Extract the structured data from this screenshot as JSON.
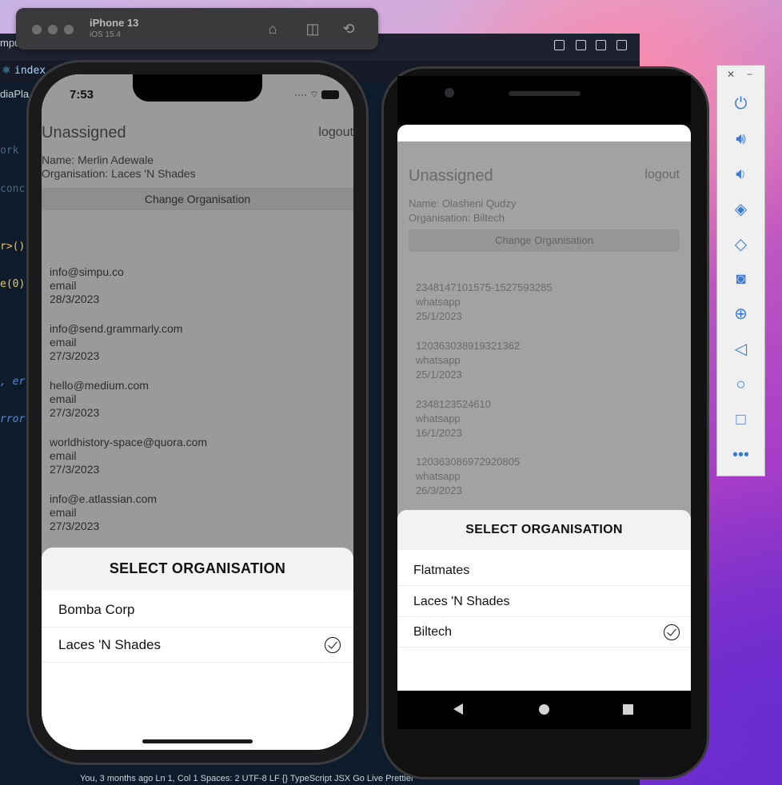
{
  "simulator": {
    "device_name": "iPhone 13",
    "os_version": "iOS 15.4"
  },
  "editor": {
    "tab_label": "index",
    "sidebar_fragment": "diaPla",
    "top_fragment": "mpu",
    "status_bar": "You, 3 months ago    Ln 1, Col 1    Spaces: 2    UTF-8    LF    {} TypeScript JSX    Go Live    Prettier",
    "code_fragments": [
      "ork",
      "conc",
      "r>()",
      "e(0)",
      ", er",
      "rror"
    ]
  },
  "ios": {
    "time": "7:53",
    "title": "Unassigned",
    "logout": "logout",
    "name_line": "Name: Merlin Adewale",
    "org_line": "Organisation: Laces 'N Shades",
    "change_button": "Change Organisation",
    "items": [
      {
        "contact": "info@simpu.co",
        "channel": "email",
        "date": "28/3/2023"
      },
      {
        "contact": "info@send.grammarly.com",
        "channel": "email",
        "date": "27/3/2023"
      },
      {
        "contact": "hello@medium.com",
        "channel": "email",
        "date": "27/3/2023"
      },
      {
        "contact": "worldhistory-space@quora.com",
        "channel": "email",
        "date": "27/3/2023"
      },
      {
        "contact": "info@e.atlassian.com",
        "channel": "email",
        "date": "27/3/2023"
      }
    ],
    "sheet_title": "SELECT ORGANISATION",
    "options": [
      "Bomba Corp",
      "Laces 'N Shades"
    ],
    "selected_option": "Laces 'N Shades"
  },
  "android": {
    "title": "Unassigned",
    "logout": "logout",
    "name_line": "Name: Olasheni Qudzy",
    "org_line": "Organisation: Biltech",
    "change_button": "Change Organisation",
    "items": [
      {
        "contact": "2348147101575-1527593285",
        "channel": "whatsapp",
        "date": "25/1/2023"
      },
      {
        "contact": "120363038919321362",
        "channel": "whatsapp",
        "date": "25/1/2023"
      },
      {
        "contact": "2348123524610",
        "channel": "whatsapp",
        "date": "16/1/2023"
      },
      {
        "contact": "120363086972920805",
        "channel": "whatsapp",
        "date": "26/3/2023"
      }
    ],
    "sheet_title": "SELECT ORGANISATION",
    "options": [
      "Flatmates",
      "Laces 'N Shades",
      "Biltech"
    ],
    "selected_option": "Biltech"
  },
  "emulator_panel": {
    "close": "✕",
    "minimize": "−",
    "buttons": [
      "power-icon",
      "volume-up-icon",
      "volume-down-icon",
      "rotate-left-icon",
      "rotate-right-icon",
      "camera-icon",
      "zoom-icon",
      "back-icon",
      "home-icon",
      "overview-icon",
      "more-icon"
    ]
  },
  "colors": {
    "dim_overlay": "#9a9a9a",
    "emulator_accent": "#3a7bd5",
    "editor_bg": "#0d1b2a"
  }
}
